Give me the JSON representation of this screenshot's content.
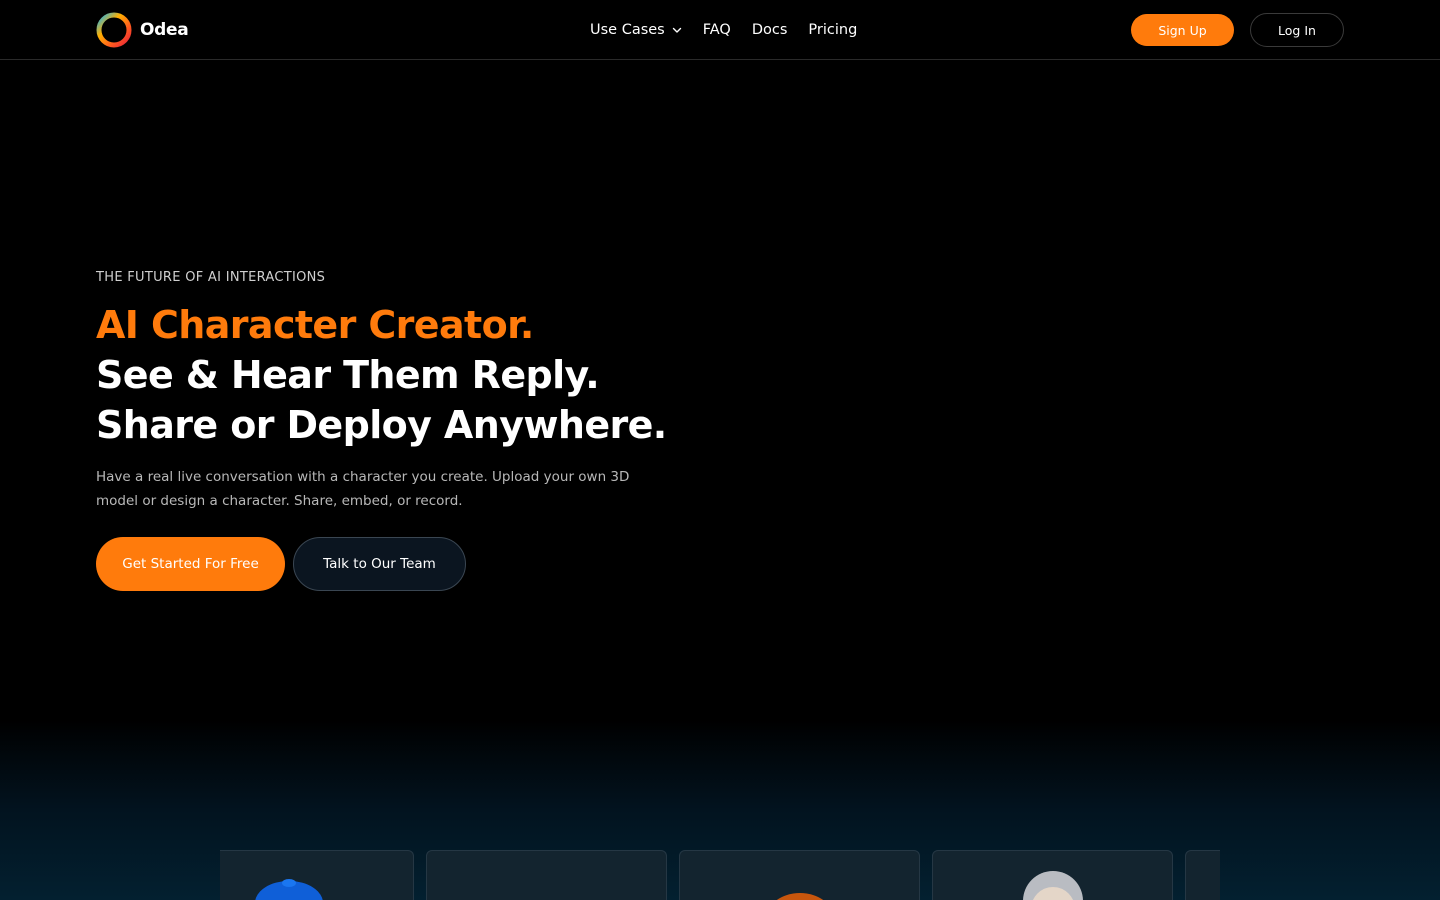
{
  "brand": {
    "name": "Odea",
    "icon": "ring-logo-icon"
  },
  "nav": {
    "items": [
      {
        "label": "Use Cases",
        "has_dropdown": true
      },
      {
        "label": "FAQ"
      },
      {
        "label": "Docs"
      },
      {
        "label": "Pricing"
      }
    ]
  },
  "header": {
    "signup_label": "Sign Up",
    "login_label": "Log In"
  },
  "hero": {
    "eyebrow": "THE FUTURE OF AI INTERACTIONS",
    "line1": "AI Character Creator.",
    "line2": "See & Hear Them Reply.",
    "line3": "Share or Deploy Anywhere.",
    "subtext": "Have a real live conversation with a character you create. Upload your own 3D model or design a character. Share, embed, or record.",
    "cta_primary": "Get Started For Free",
    "cta_secondary": "Talk to Our Team"
  },
  "colors": {
    "accent": "#ff7b0c",
    "background": "#000000",
    "card": "#13242f"
  },
  "cards": [
    {
      "name": "character-card-blue",
      "avatar_icon": "blue-character-icon"
    },
    {
      "name": "character-card-empty",
      "avatar_icon": ""
    },
    {
      "name": "character-card-orange",
      "avatar_icon": "orange-character-icon"
    },
    {
      "name": "character-card-person",
      "avatar_icon": "gray-hair-person-icon"
    },
    {
      "name": "character-card-partial",
      "avatar_icon": ""
    }
  ]
}
